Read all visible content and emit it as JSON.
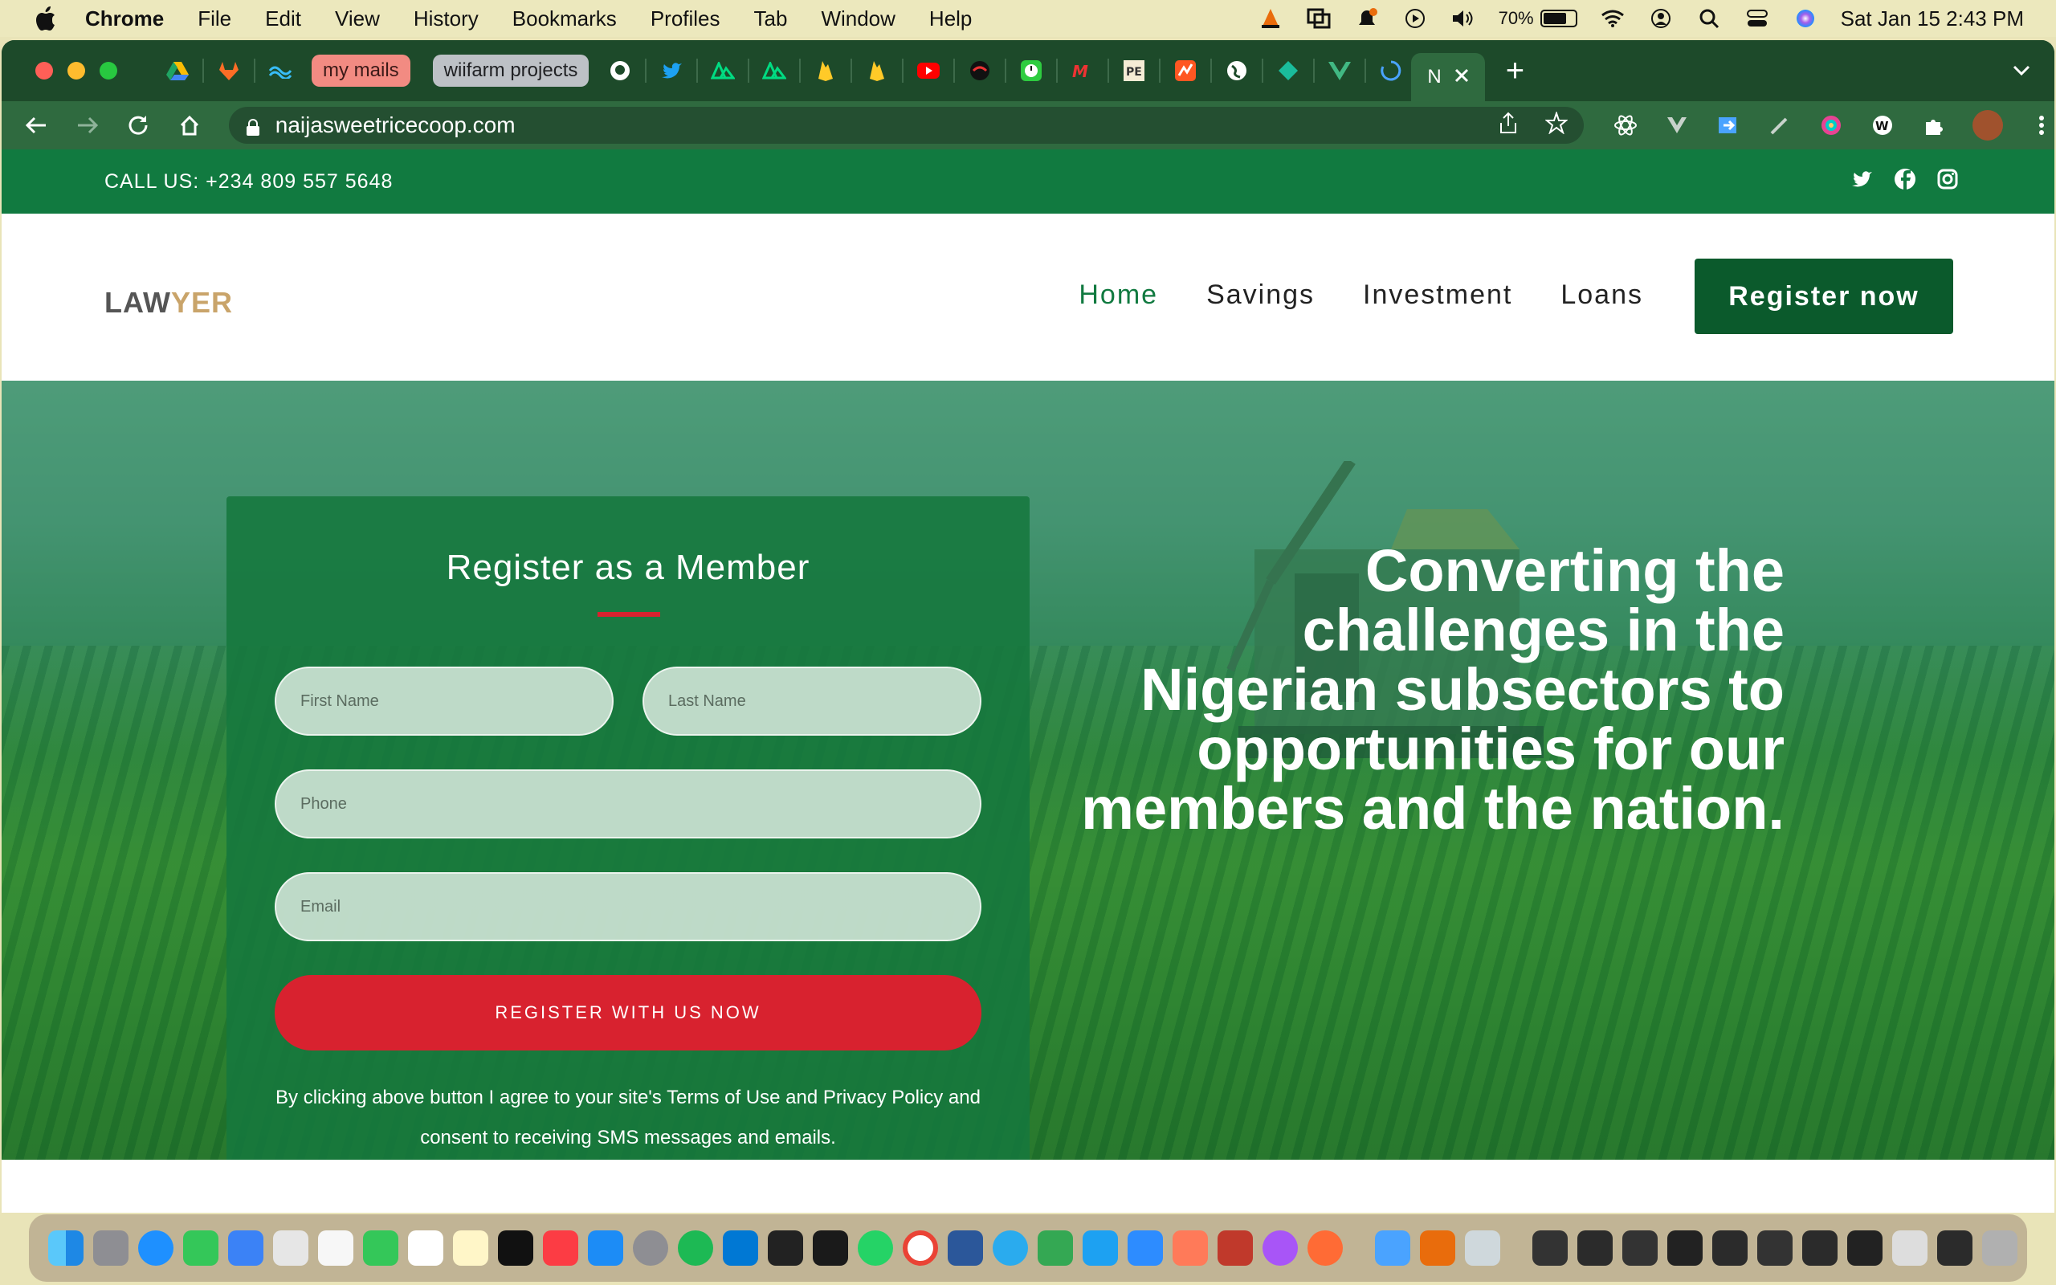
{
  "menubar": {
    "app": "Chrome",
    "items": [
      "File",
      "Edit",
      "View",
      "History",
      "Bookmarks",
      "Profiles",
      "Tab",
      "Window",
      "Help"
    ],
    "battery": "70%",
    "datetime": "Sat Jan 15  2:43 PM"
  },
  "browser": {
    "tab_groups": [
      {
        "label": "my mails",
        "color": "#f28b82"
      },
      {
        "label": "wiifarm projects",
        "color": "#bdc1c6"
      }
    ],
    "active_tab_label": "N",
    "url": "naijasweetricecoop.com"
  },
  "site": {
    "topbar": {
      "phone": "CALL US: +234 809 557 5648"
    },
    "logo": {
      "part1": "LAW",
      "part2": "YER"
    },
    "nav": [
      {
        "label": "Home",
        "active": true
      },
      {
        "label": "Savings",
        "active": false
      },
      {
        "label": "Investment",
        "active": false
      },
      {
        "label": "Loans",
        "active": false
      }
    ],
    "cta": "Register now",
    "form": {
      "title": "Register as a Member",
      "first_name_placeholder": "First Name",
      "last_name_placeholder": "Last Name",
      "phone_placeholder": "Phone",
      "email_placeholder": "Email",
      "submit": "REGISTER WITH US NOW",
      "consent_line1": "By clicking above button I agree to your site's Terms of Use and Privacy Policy and",
      "consent_line2": "consent to receiving SMS messages and emails."
    },
    "headline": "Converting the challenges in the Nigerian subsectors to opportunities for our members and the nation."
  },
  "colors": {
    "brand_green": "#117a40",
    "dark_green": "#0b5a2c",
    "accent_red": "#d8222f",
    "logo_gold": "#c9a46a"
  }
}
